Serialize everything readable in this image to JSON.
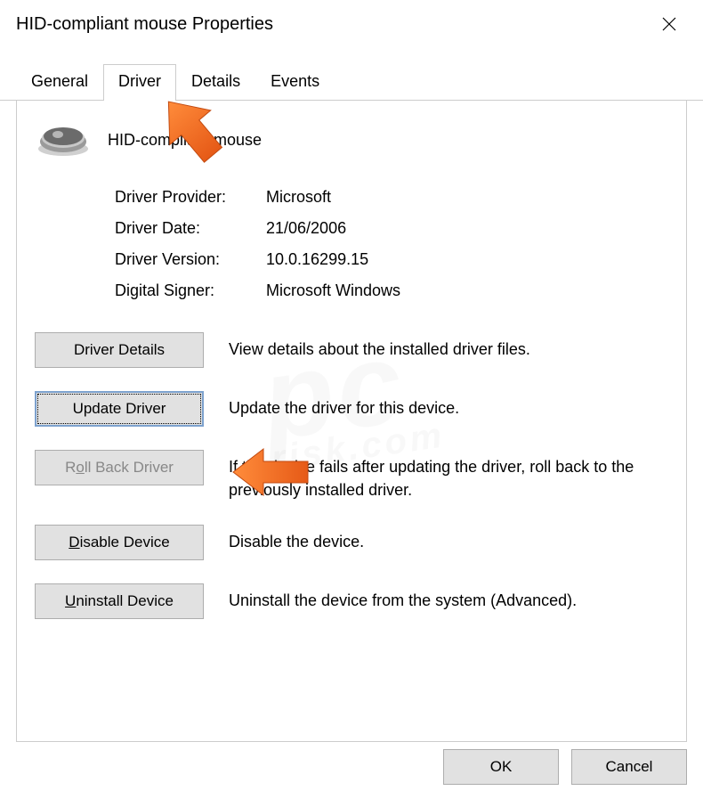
{
  "window": {
    "title": "HID-compliant mouse Properties"
  },
  "tabs": {
    "general": "General",
    "driver": "Driver",
    "details": "Details",
    "events": "Events"
  },
  "device": {
    "name": "HID-compliant mouse"
  },
  "info": {
    "provider_label": "Driver Provider:",
    "provider_value": "Microsoft",
    "date_label": "Driver Date:",
    "date_value": "21/06/2006",
    "version_label": "Driver Version:",
    "version_value": "10.0.16299.15",
    "signer_label": "Digital Signer:",
    "signer_value": "Microsoft Windows"
  },
  "actions": {
    "details_btn": "Driver Details",
    "details_desc": "View details about the installed driver files.",
    "update_btn": "Update Driver",
    "update_desc": "Update the driver for this device.",
    "rollback_btn_pre": "R",
    "rollback_btn_mid": "o",
    "rollback_btn_post": "ll Back Driver",
    "rollback_desc": "If the device fails after updating the driver, roll back to the previously installed driver.",
    "disable_btn_pre": "",
    "disable_btn_mid": "D",
    "disable_btn_post": "isable Device",
    "disable_desc": "Disable the device.",
    "uninstall_btn_pre": "",
    "uninstall_btn_mid": "U",
    "uninstall_btn_post": "ninstall Device",
    "uninstall_desc": "Uninstall the device from the system (Advanced)."
  },
  "footer": {
    "ok": "OK",
    "cancel": "Cancel"
  },
  "watermark": {
    "main": "pc",
    "sub": "risk.com"
  }
}
